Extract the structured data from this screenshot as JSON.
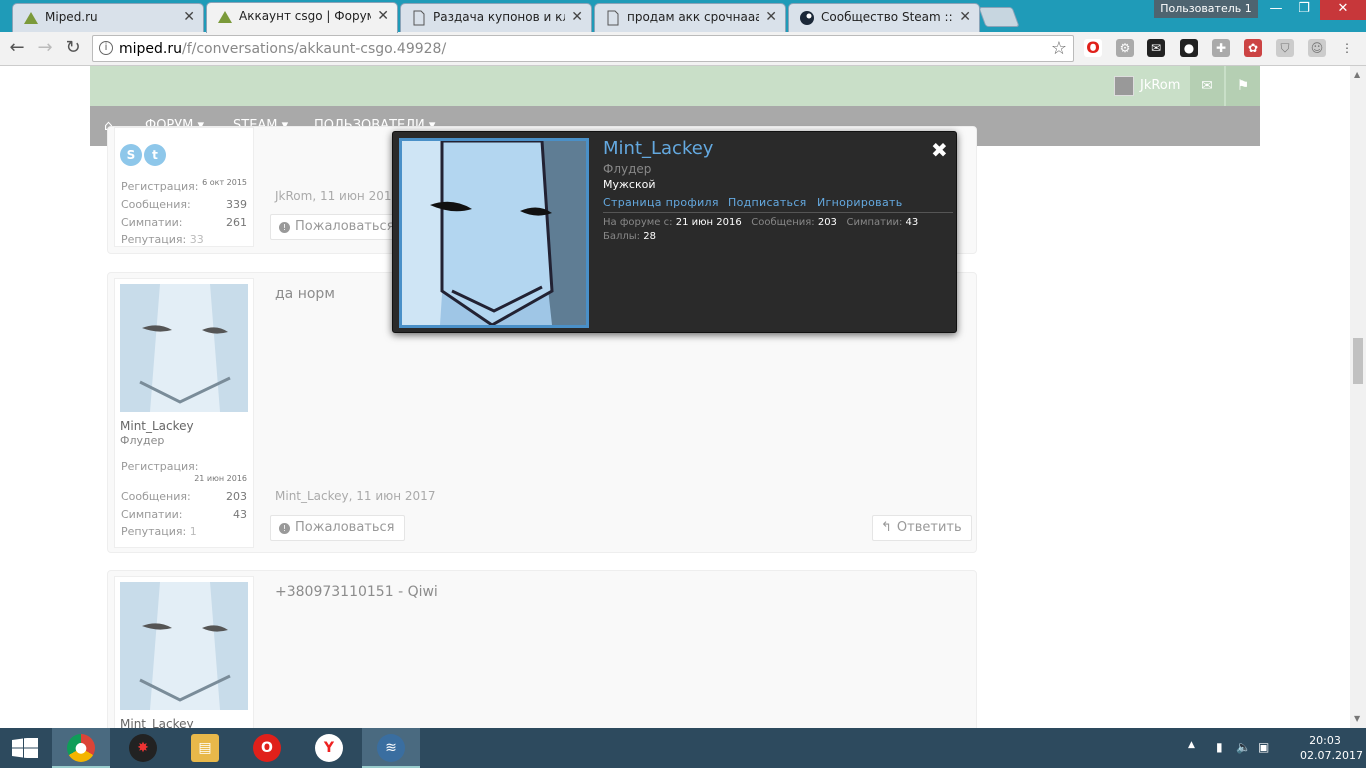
{
  "browser": {
    "tabs": [
      {
        "title": "Miped.ru",
        "active": false
      },
      {
        "title": "Аккаунт csgo | Форум M",
        "active": true
      },
      {
        "title": "Раздача купонов и клю",
        "active": false
      },
      {
        "title": "продам акк срочнааа | (",
        "active": false
      },
      {
        "title": "Сообщество Steam :: Of",
        "active": false
      }
    ],
    "profile_name": "Пользователь 1",
    "url_host": "miped.ru",
    "url_path": "/f/conversations/akkaunt-csgo.49928/"
  },
  "header": {
    "username": "JkRom",
    "nav": [
      "ФОРУМ",
      "STEAM",
      "ПОЛЬЗОВАТЕЛИ"
    ]
  },
  "post1": {
    "stats": [
      {
        "label": "Регистрация:",
        "value": "6 окт 2015"
      },
      {
        "label": "Сообщения:",
        "value": "339"
      },
      {
        "label": "Симпатии:",
        "value": "261"
      },
      {
        "label": "Репутация:",
        "value": "33"
      }
    ],
    "meta": "JkRom, 11 июн 2017",
    "report": "Пожаловаться"
  },
  "post2": {
    "username": "Mint_Lackey",
    "user_title": "Флудер",
    "stats": [
      {
        "label": "Регистрация:",
        "value": "21 июн 2016"
      },
      {
        "label": "Сообщения:",
        "value": "203"
      },
      {
        "label": "Симпатии:",
        "value": "43"
      },
      {
        "label": "Репутация:",
        "value": "1"
      }
    ],
    "message": "да норм",
    "meta": "Mint_Lackey, 11 июн 2017",
    "report": "Пожаловаться",
    "reply": "Ответить"
  },
  "post3": {
    "username": "Mint_Lackey",
    "message": "+380973110151 - Qiwi"
  },
  "card": {
    "name": "Mint_Lackey",
    "title": "Флудер",
    "gender": "Мужской",
    "links": [
      "Страница профиля",
      "Подписаться",
      "Игнорировать"
    ],
    "since_label": "На форуме с:",
    "since_value": "21 июн 2016",
    "messages_label": "Сообщения:",
    "messages_value": "203",
    "likes_label": "Симпатии:",
    "likes_value": "43",
    "points_label": "Баллы:",
    "points_value": "28"
  },
  "taskbar": {
    "time": "20:03",
    "date": "02.07.2017"
  },
  "colors": {
    "accent": "#64a9e0",
    "header_band": "#c9dfc8",
    "navbar": "#a9a9a9",
    "taskbar": "#2d4a5e"
  }
}
